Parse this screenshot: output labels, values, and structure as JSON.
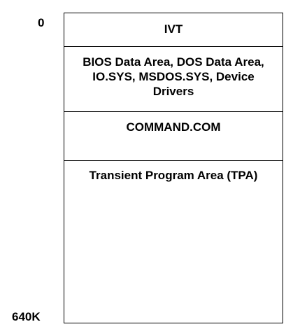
{
  "addresses": {
    "start": "0",
    "end": "640K"
  },
  "regions": [
    {
      "label": "IVT"
    },
    {
      "label": "BIOS Data Area, DOS Data Area, IO.SYS, MSDOS.SYS, Device Drivers"
    },
    {
      "label": "COMMAND.COM"
    },
    {
      "label": "Transient Program Area (TPA)"
    }
  ],
  "colors": {
    "line": "#000000",
    "background": "#ffffff"
  }
}
